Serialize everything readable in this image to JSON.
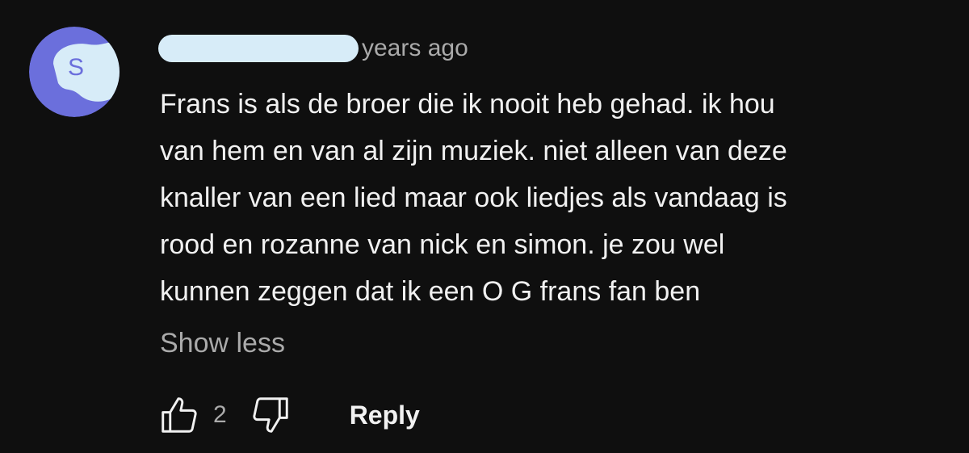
{
  "comment": {
    "author": "",
    "timestamp": "years ago",
    "avatar_letter": "S",
    "avatar_color": "#6b6fdc",
    "text": "Frans is als de broer die ik nooit heb gehad. ik hou\nvan hem en van al zijn muziek. niet alleen van deze\nknaller van een lied maar ook liedjes als vandaag is\nrood en rozanne van nick en simon. je zou wel\nkunnen zeggen dat ik een O G frans fan ben",
    "show_less_label": "Show less"
  },
  "actions": {
    "like_icon": "thumbs-up-icon",
    "like_count": "2",
    "dislike_icon": "thumbs-down-icon",
    "reply_label": "Reply"
  },
  "colors": {
    "background": "#0f0f0f",
    "text": "#f1f1f1",
    "secondary_text": "#aaaaaa",
    "redaction": "#d7ecf8"
  }
}
